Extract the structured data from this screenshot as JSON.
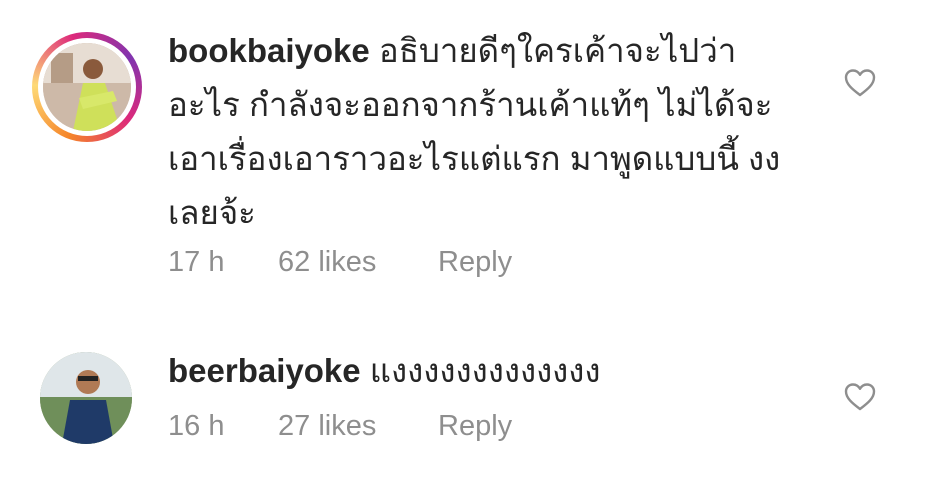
{
  "comments": [
    {
      "username": "bookbaiyoke",
      "text": "อธิบายดีๆใครเค้าจะไปว่า อะไร กำลังจะออกจากร้านเค้าแท้ๆ ไม่ได้จะ เอาเรื่องเอาราวอะไรแต่แรก มาพูดแบบนี้ งง เลยจ้ะ",
      "lines": [
        "อธิบายดีๆใครเค้าจะไปว่า",
        "อะไร กำลังจะออกจากร้านเค้าแท้ๆ ไม่ได้จะ",
        "เอาเรื่องเอาราวอะไรแต่แรก มาพูดแบบนี้ งง",
        "เลยจ้ะ"
      ],
      "time": "17 h",
      "likes": "62 likes",
      "reply_label": "Reply",
      "like_icon": "heart-outline-icon",
      "has_story_ring": true
    },
    {
      "username": "beerbaiyoke",
      "text": "แงงงงงงงงงงงงง",
      "time": "16 h",
      "likes": "27 likes",
      "reply_label": "Reply",
      "like_icon": "heart-outline-icon",
      "has_story_ring": false
    }
  ],
  "colors": {
    "text": "#262626",
    "meta": "#8e8e8e",
    "heart_stroke": "#8e8e8e",
    "story_ring": [
      "#f58529",
      "#feda77",
      "#dd2a7b",
      "#8134af"
    ]
  }
}
